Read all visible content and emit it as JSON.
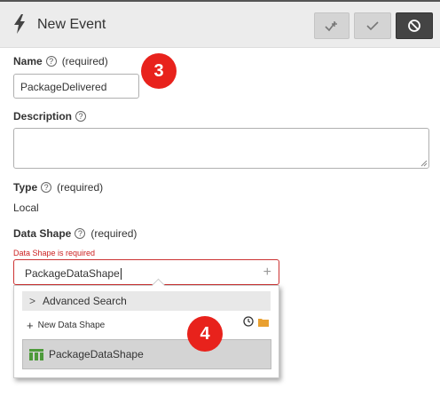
{
  "header": {
    "title": "New Event",
    "buttons": [
      {
        "icon": "check-plus-icon"
      },
      {
        "icon": "check-icon"
      },
      {
        "icon": "cancel-icon"
      }
    ]
  },
  "form": {
    "name": {
      "label": "Name",
      "required": "(required)",
      "value": "PackageDelivered"
    },
    "description": {
      "label": "Description",
      "value": ""
    },
    "type": {
      "label": "Type",
      "required": "(required)",
      "value": "Local"
    },
    "data_shape": {
      "label": "Data Shape",
      "required": "(required)",
      "error": "Data Shape is required",
      "value": "PackageDataShape"
    }
  },
  "dropdown": {
    "advanced_search": "Advanced Search",
    "new_data_shape": "New Data Shape",
    "results": [
      "PackageDataShape"
    ]
  },
  "annotations": [
    "3",
    "4"
  ],
  "colors": {
    "badge": "#e8221c",
    "error": "#cc2222",
    "header_bg": "#ececec",
    "cancel_button_bg": "#444444",
    "result_bg": "#d4d4d4",
    "folder_icon": "#e9a030",
    "data_shape_icon": "#4d9a3a"
  }
}
